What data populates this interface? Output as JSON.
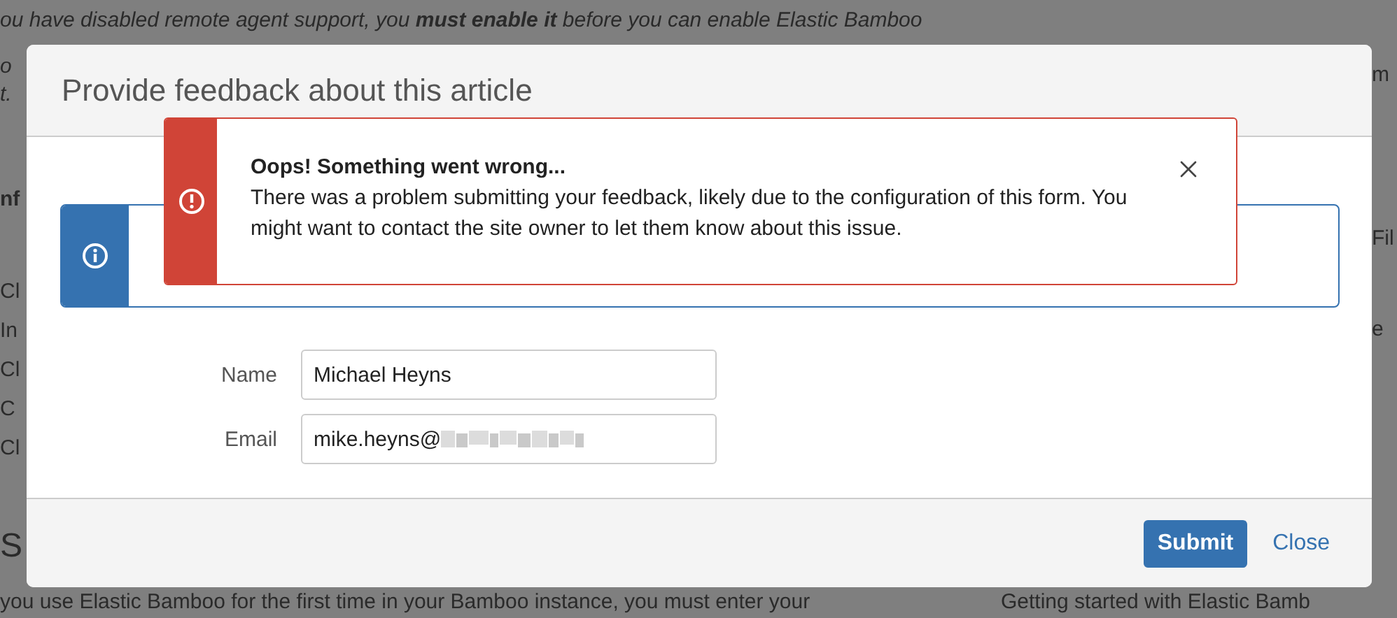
{
  "background": {
    "top_line": "ou have disabled remote agent support, you **must enable it** before you can enable Elastic Bamboo",
    "left_fragments": [
      {
        "text": "o",
        "kind": "italic"
      },
      {
        "text": "t.",
        "kind": "italic"
      },
      {
        "text": "nf",
        "kind": "bold"
      },
      {
        "text": "Cl",
        "kind": "plain"
      },
      {
        "text": "In",
        "kind": "plain"
      },
      {
        "text": "Cl",
        "kind": "plain"
      },
      {
        "text": "C",
        "kind": "plain"
      },
      {
        "text": "Cl",
        "kind": "plain"
      },
      {
        "text": "S",
        "kind": "heading"
      }
    ],
    "right_fragments": [
      {
        "text": "m"
      },
      {
        "text": "Fil"
      },
      {
        "text": "e"
      }
    ],
    "bottom_left": "you use Elastic Bamboo for the first time in your Bamboo instance, you must enter your",
    "bottom_right": "Getting started with Elastic Bamb"
  },
  "dialog": {
    "title": "Provide feedback about this article",
    "error": {
      "title": "Oops! Something went wrong...",
      "message": "There was a problem submitting your feedback, likely due to the configuration of this form. You might want to contact the site owner to let them know about this issue."
    },
    "fields": [
      {
        "label": "Name",
        "value": "Michael Heyns",
        "redacted": false
      },
      {
        "label": "Email",
        "value": "mike.heyns@",
        "redacted": true
      }
    ],
    "buttons": [
      {
        "label": "Submit",
        "kind": "primary"
      },
      {
        "label": "Close",
        "kind": "link"
      }
    ]
  }
}
